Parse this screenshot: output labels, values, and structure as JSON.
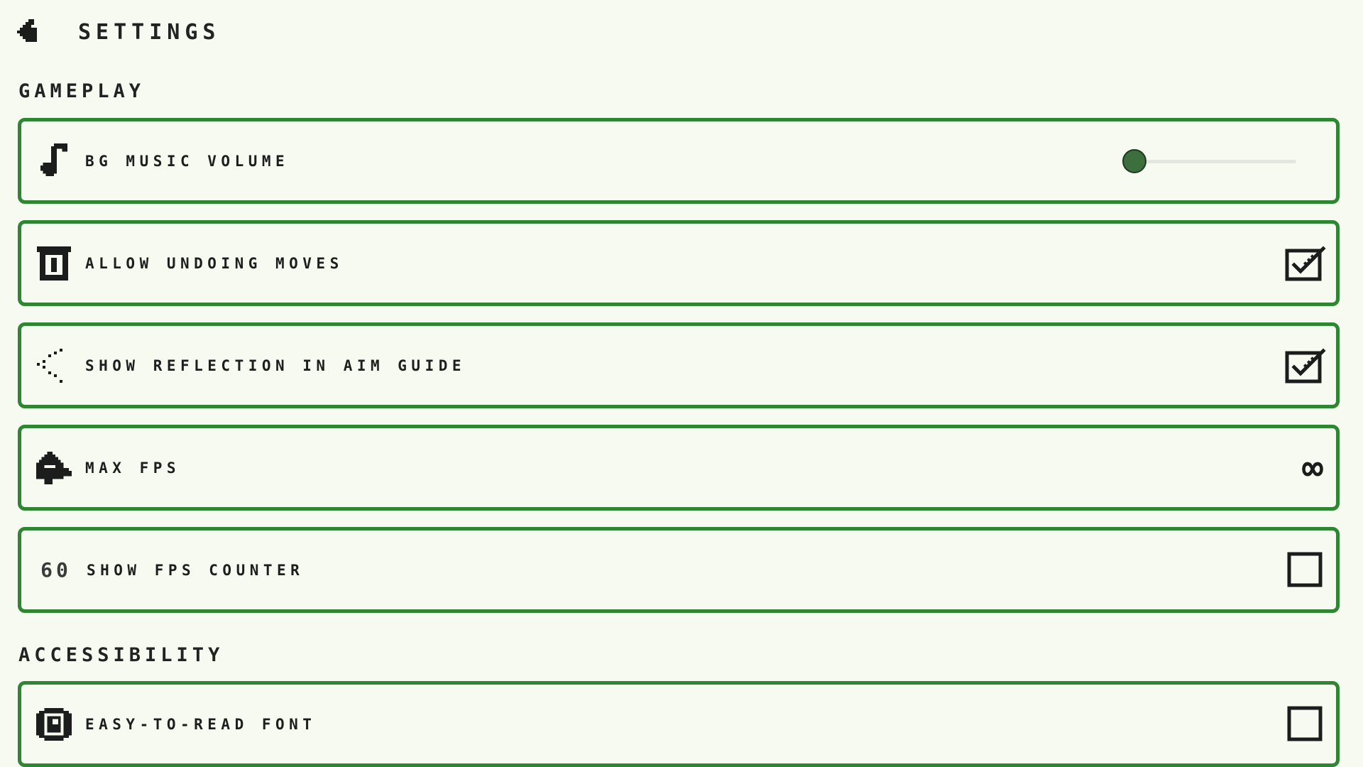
{
  "header": {
    "back_icon": "pixel-arrow-left-icon",
    "title": "SETTINGS"
  },
  "sections": [
    {
      "title": "GAMEPLAY",
      "rows": [
        {
          "icon": "music-note-icon",
          "label": "BG MUSIC VOLUME",
          "control": "slider",
          "value": 0
        },
        {
          "icon": "trash-can-icon",
          "label": "ALLOW UNDOING MOVES",
          "control": "checkbox",
          "checked": true
        },
        {
          "icon": "reflection-dots-icon",
          "label": "SHOW REFLECTION IN AIM GUIDE",
          "control": "checkbox",
          "checked": true
        },
        {
          "icon": "speed-hand-icon",
          "label": "MAX FPS",
          "control": "value",
          "value": "∞"
        },
        {
          "icon_text": "60",
          "label": "SHOW FPS COUNTER",
          "control": "checkbox",
          "checked": false
        }
      ]
    },
    {
      "title": "ACCESSIBILITY",
      "rows": [
        {
          "icon": "eye-icon",
          "label": "EASY-TO-READ FONT",
          "control": "checkbox",
          "checked": false
        }
      ]
    }
  ],
  "colors": {
    "background": "#f6faf1",
    "card_border": "#2e8632",
    "slider_knob": "#3d6e3d",
    "slider_track": "#e3e6e1",
    "text": "#1e1e1e"
  }
}
